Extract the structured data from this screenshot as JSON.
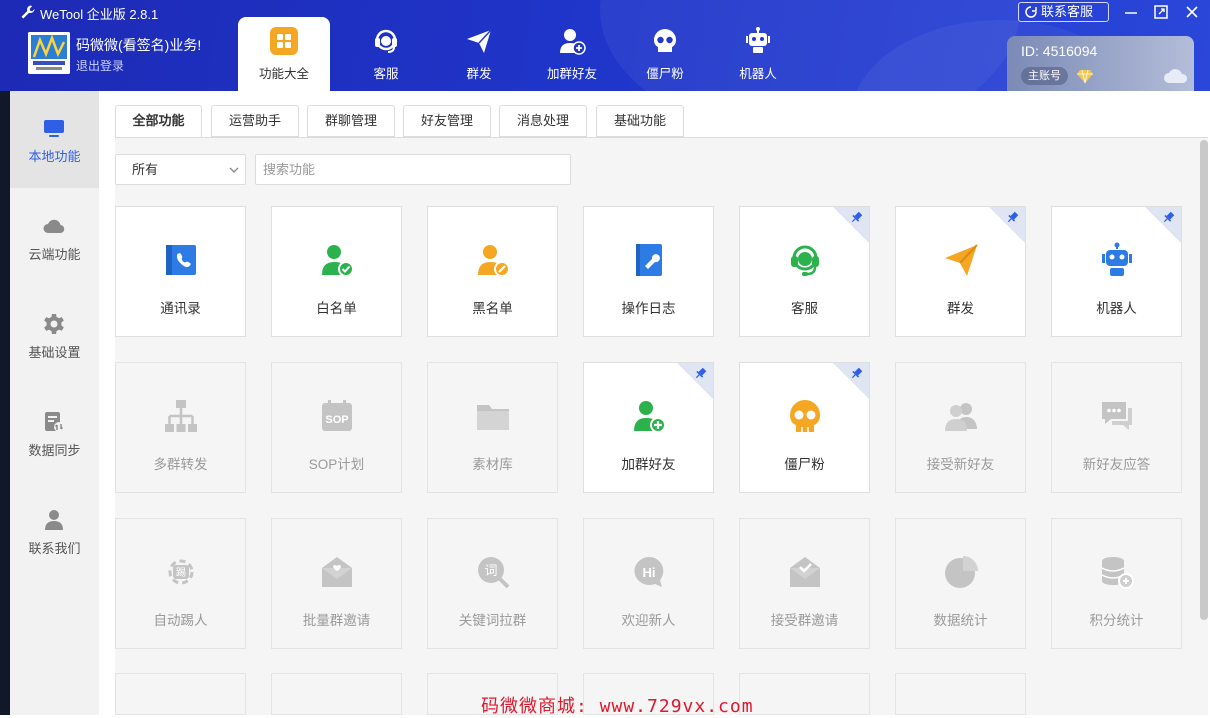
{
  "window": {
    "title": "WeTool 企业版 2.8.1",
    "contact_label": "联系客服"
  },
  "user": {
    "name": "码微微(看签名)业务!",
    "logout": "退出登录"
  },
  "nav": [
    {
      "label": "功能大全",
      "icon": "grid-icon"
    },
    {
      "label": "客服",
      "icon": "headset-icon"
    },
    {
      "label": "群发",
      "icon": "paper-plane-icon"
    },
    {
      "label": "加群好友",
      "icon": "add-user-icon"
    },
    {
      "label": "僵尸粉",
      "icon": "skull-icon"
    },
    {
      "label": "机器人",
      "icon": "robot-icon"
    }
  ],
  "account": {
    "id": "ID: 4516094",
    "role": "主账号"
  },
  "sidebar": [
    {
      "label": "本地功能",
      "icon": "monitor-icon"
    },
    {
      "label": "云端功能",
      "icon": "cloud-icon"
    },
    {
      "label": "基础设置",
      "icon": "gear-icon"
    },
    {
      "label": "数据同步",
      "icon": "sync-icon"
    },
    {
      "label": "联系我们",
      "icon": "person-icon"
    }
  ],
  "subtabs": [
    "全部功能",
    "运营助手",
    "群聊管理",
    "好友管理",
    "消息处理",
    "基础功能"
  ],
  "filter": {
    "selected": "所有",
    "search_placeholder": "搜索功能"
  },
  "cards": [
    {
      "label": "通讯录",
      "icon": "contacts-icon",
      "enabled": true,
      "pinned": false
    },
    {
      "label": "白名单",
      "icon": "whitelist-icon",
      "enabled": true,
      "pinned": false
    },
    {
      "label": "黑名单",
      "icon": "blacklist-icon",
      "enabled": true,
      "pinned": false
    },
    {
      "label": "操作日志",
      "icon": "log-icon",
      "enabled": true,
      "pinned": false
    },
    {
      "label": "客服",
      "icon": "headset-icon",
      "enabled": true,
      "pinned": true
    },
    {
      "label": "群发",
      "icon": "paper-plane-icon",
      "enabled": true,
      "pinned": true
    },
    {
      "label": "机器人",
      "icon": "robot-icon",
      "enabled": true,
      "pinned": true
    },
    {
      "label": "多群转发",
      "icon": "hierarchy-icon",
      "enabled": false,
      "pinned": false
    },
    {
      "label": "SOP计划",
      "icon": "sop-calendar-icon",
      "enabled": false,
      "pinned": false
    },
    {
      "label": "素材库",
      "icon": "folder-icon",
      "enabled": false,
      "pinned": false
    },
    {
      "label": "加群好友",
      "icon": "add-user-icon",
      "enabled": true,
      "pinned": true
    },
    {
      "label": "僵尸粉",
      "icon": "skull-icon",
      "enabled": true,
      "pinned": true
    },
    {
      "label": "接受新好友",
      "icon": "users-icon",
      "enabled": false,
      "pinned": false
    },
    {
      "label": "新好友应答",
      "icon": "chat-icon",
      "enabled": false,
      "pinned": false
    },
    {
      "label": "自动踢人",
      "icon": "kick-icon",
      "enabled": false,
      "pinned": false
    },
    {
      "label": "批量群邀请",
      "icon": "invite-mail-icon",
      "enabled": false,
      "pinned": false
    },
    {
      "label": "关键词拉群",
      "icon": "keyword-icon",
      "enabled": false,
      "pinned": false
    },
    {
      "label": "欢迎新人",
      "icon": "hi-bubble-icon",
      "enabled": false,
      "pinned": false
    },
    {
      "label": "接受群邀请",
      "icon": "accept-mail-icon",
      "enabled": false,
      "pinned": false
    },
    {
      "label": "数据统计",
      "icon": "pie-chart-icon",
      "enabled": false,
      "pinned": false
    },
    {
      "label": "积分统计",
      "icon": "coins-icon",
      "enabled": false,
      "pinned": false
    }
  ],
  "watermark": "码微微商城: www.729vx.com"
}
